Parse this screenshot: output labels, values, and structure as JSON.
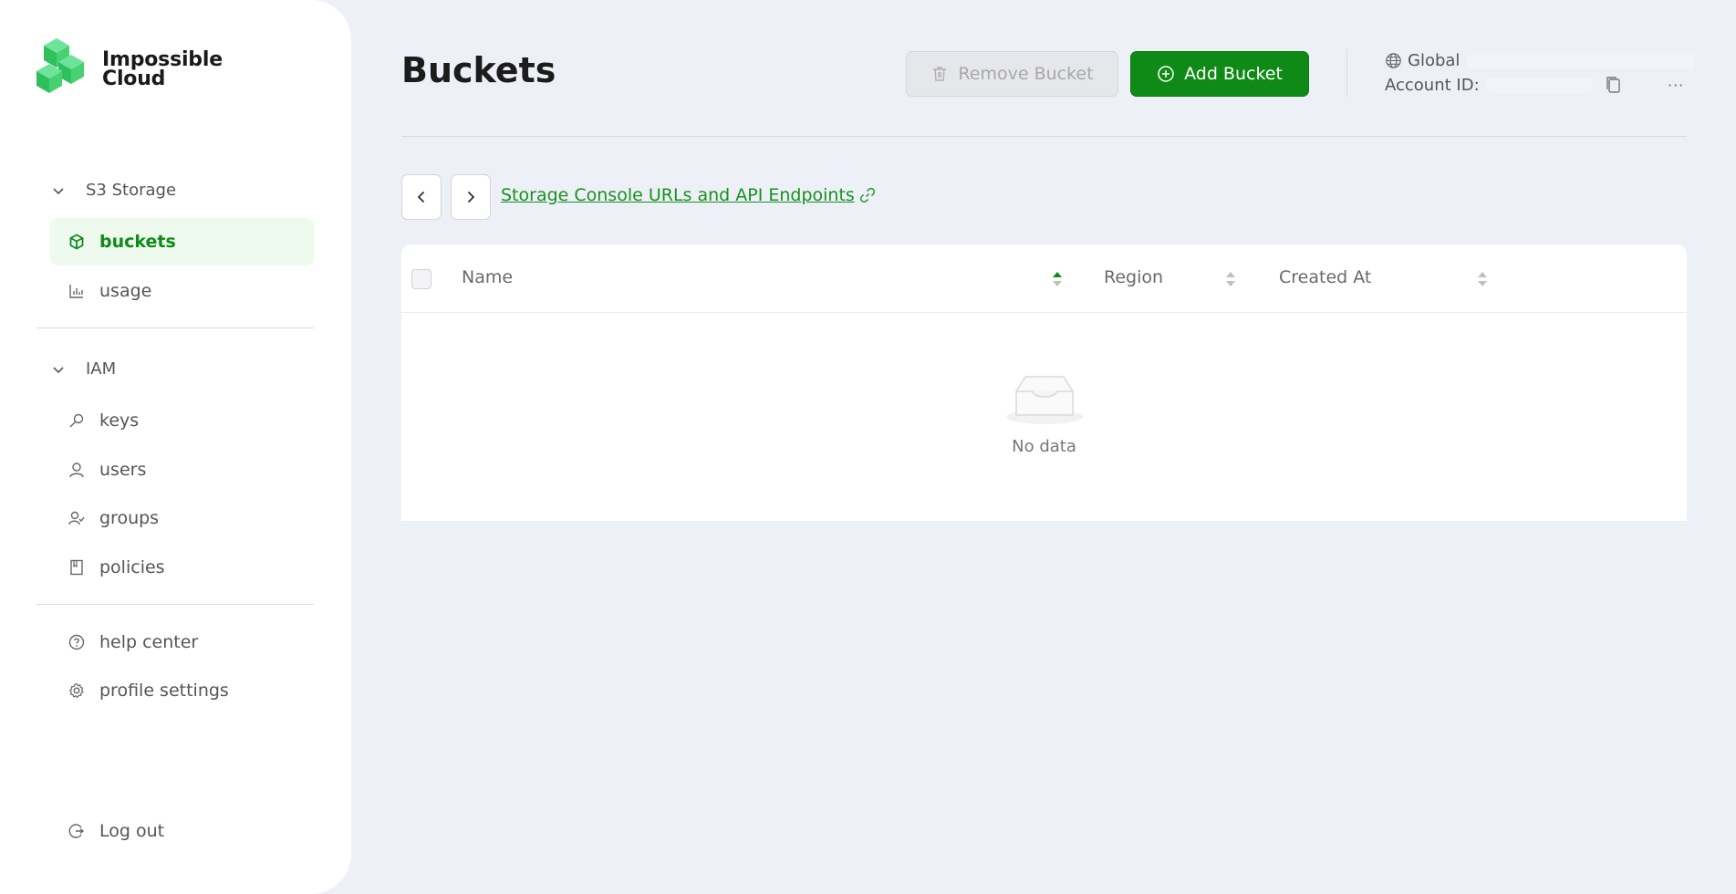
{
  "brand": {
    "name_line1": "Impossible",
    "name_line2": "Cloud",
    "color": "#3ecf6b"
  },
  "sidebar": {
    "sections": [
      {
        "label": "S3 Storage",
        "items": [
          {
            "label": "buckets",
            "icon": "cube-icon",
            "active": true
          },
          {
            "label": "usage",
            "icon": "bar-chart-icon",
            "active": false
          }
        ]
      },
      {
        "label": "IAM",
        "items": [
          {
            "label": "keys",
            "icon": "key-icon"
          },
          {
            "label": "users",
            "icon": "user-icon"
          },
          {
            "label": "groups",
            "icon": "users-icon"
          },
          {
            "label": "policies",
            "icon": "book-icon"
          }
        ]
      }
    ],
    "footer_items": [
      {
        "label": "help center",
        "icon": "question-circle-icon"
      },
      {
        "label": "profile settings",
        "icon": "gear-icon"
      }
    ],
    "logout": {
      "label": "Log out",
      "icon": "logout-icon"
    }
  },
  "header": {
    "title": "Buckets",
    "remove_button": "Remove Bucket",
    "add_button": "Add Bucket",
    "region_label": "Global",
    "account_label": "Account ID:",
    "more_label": "···"
  },
  "toolbar": {
    "endpoints_link": "Storage Console URLs and API Endpoints"
  },
  "table": {
    "columns": [
      {
        "label": "Name",
        "sort": "ascending"
      },
      {
        "label": "Region",
        "sort": "none"
      },
      {
        "label": "Created At",
        "sort": "none"
      }
    ],
    "rows": [],
    "empty_text": "No data"
  },
  "colors": {
    "accent": "#0f8a16",
    "active_bg": "#eefaee",
    "background": "#eef0f7"
  }
}
